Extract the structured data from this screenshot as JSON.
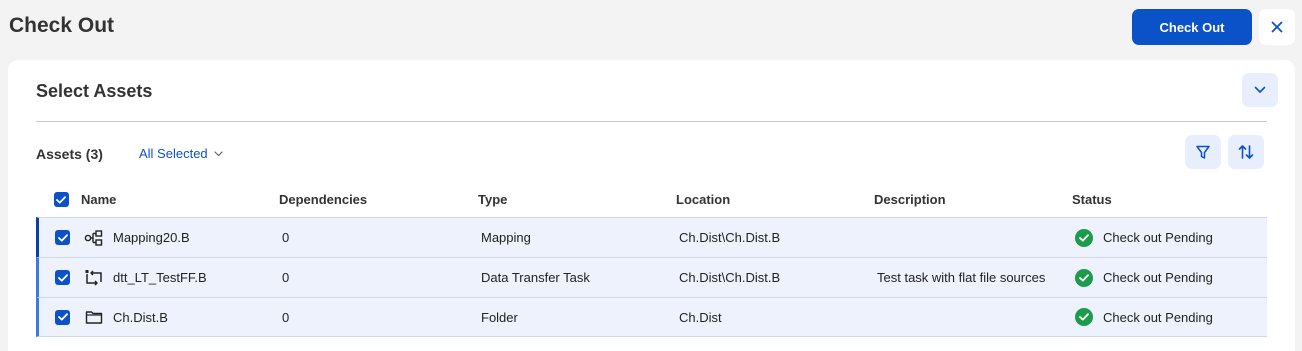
{
  "header": {
    "title": "Check Out",
    "checkout_label": "Check Out"
  },
  "section": {
    "title": "Select Assets"
  },
  "toolbar": {
    "assets_label": "Assets (3)",
    "selection_filter": "All Selected"
  },
  "table": {
    "columns": {
      "name": "Name",
      "dependencies": "Dependencies",
      "type": "Type",
      "location": "Location",
      "description": "Description",
      "status": "Status"
    },
    "rows": [
      {
        "name": "Mapping20.B",
        "icon": "mapping-icon",
        "dependencies": "0",
        "type": "Mapping",
        "location": "Ch.Dist\\Ch.Dist.B",
        "description": "",
        "status": "Check out Pending",
        "checked": true
      },
      {
        "name": "dtt_LT_TestFF.B",
        "icon": "data-transfer-icon",
        "dependencies": "0",
        "type": "Data Transfer Task",
        "location": "Ch.Dist\\Ch.Dist.B",
        "description": "Test task with flat file sources",
        "status": "Check out Pending",
        "checked": true
      },
      {
        "name": "Ch.Dist.B",
        "icon": "folder-icon",
        "dependencies": "0",
        "type": "Folder",
        "location": "Ch.Dist",
        "description": "",
        "status": "Check out Pending",
        "checked": true
      }
    ]
  },
  "colors": {
    "accent": "#0b52c9",
    "row_selected_bg": "#eef2fc",
    "status_success": "#1c9b4c"
  }
}
